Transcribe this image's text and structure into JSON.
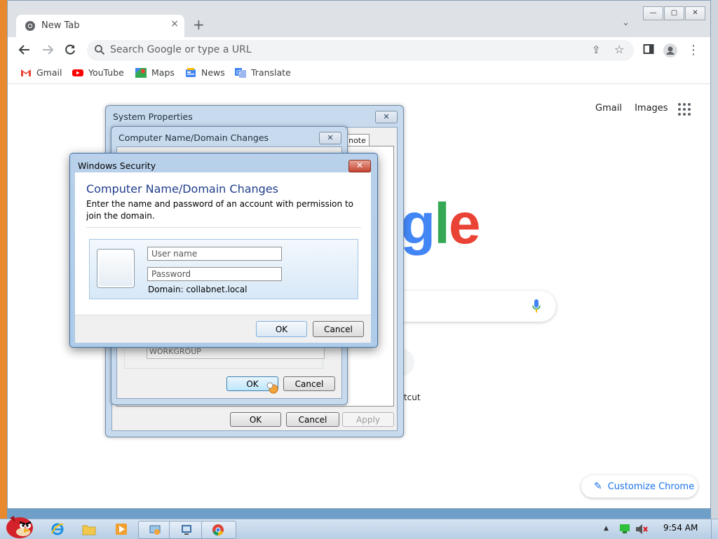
{
  "browser": {
    "tab_title": "New Tab",
    "tab_close": "×",
    "new_tab": "+",
    "tab_search": "⌄",
    "window_controls": [
      "—",
      "▢",
      "✕"
    ],
    "omnibox_placeholder": "Search Google or type a URL",
    "bookmarks": [
      {
        "label": "Gmail",
        "icon": "gmail-icon",
        "color": "#ea4335"
      },
      {
        "label": "YouTube",
        "icon": "youtube-icon",
        "color": "#ff0000"
      },
      {
        "label": "Maps",
        "icon": "maps-icon",
        "color": "#34a853"
      },
      {
        "label": "News",
        "icon": "news-icon",
        "color": "#4285f4"
      },
      {
        "label": "Translate",
        "icon": "translate-icon",
        "color": "#4285f4"
      }
    ]
  },
  "ntp": {
    "gmail_link": "Gmail",
    "images_link": "Images",
    "logo_g": "g",
    "logo_l": "l",
    "logo_e": "e",
    "shortcut_label": "rtcut",
    "customize_label": "Customize Chrome",
    "logo_colors": {
      "g": "#4285f4",
      "l": "#34a853",
      "e": "#ea4335"
    }
  },
  "system_properties": {
    "title": "System Properties",
    "tab_fragment": "note",
    "ok": "OK",
    "cancel": "Cancel",
    "apply": "Apply"
  },
  "name_changes": {
    "title": "Computer Name/Domain Changes",
    "workgroup_value": "WORKGROUP",
    "ok": "OK",
    "cancel": "Cancel"
  },
  "windows_security": {
    "title": "Windows Security",
    "heading": "Computer Name/Domain Changes",
    "description": "Enter the name and password of an account with permission to join the domain.",
    "username_placeholder": "User name",
    "password_placeholder": "Password",
    "domain_text": "Domain: collabnet.local",
    "ok": "OK",
    "cancel": "Cancel",
    "close": "✕"
  },
  "taskbar": {
    "clock": "9:54 AM",
    "tray_expand": "▲"
  }
}
